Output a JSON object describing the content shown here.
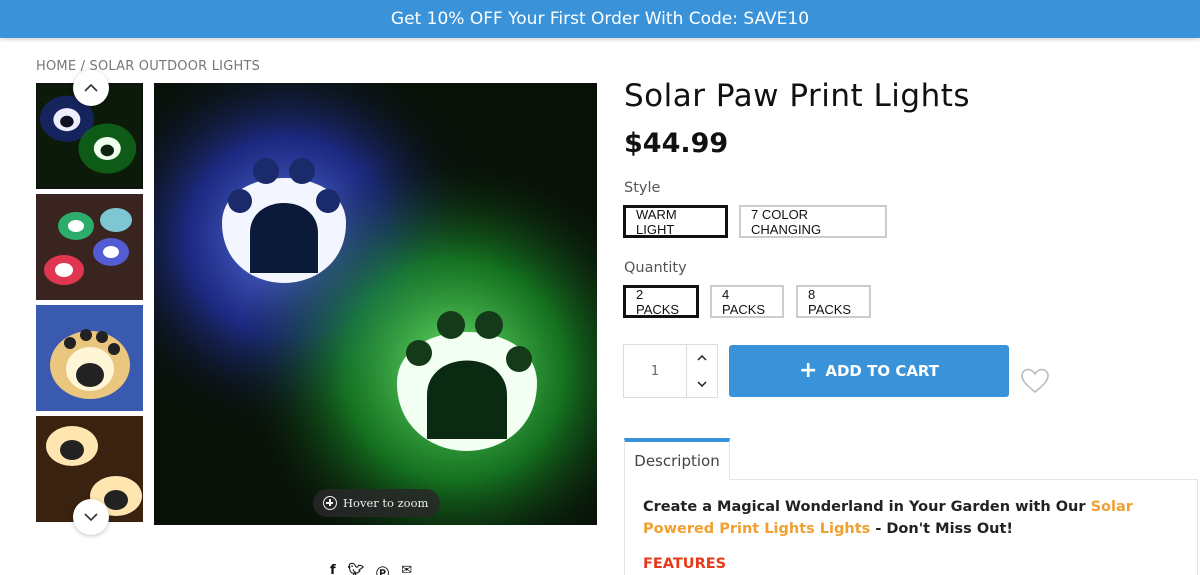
{
  "promo": {
    "text": "Get 10% OFF Your First Order With Code: SAVE10"
  },
  "breadcrumb": {
    "home": "HOME",
    "separator": " / ",
    "current": "SOLAR OUTDOOR LIGHTS"
  },
  "gallery": {
    "thumbnails": [
      "paw-lights-blue-green",
      "paw-lights-multicolor",
      "paw-light-warm",
      "paw-lights-warm-pair"
    ],
    "zoom_hint": "Hover to zoom"
  },
  "product": {
    "title": "Solar Paw Print Lights",
    "price": "$44.99",
    "style_label": "Style",
    "styles": [
      {
        "label": "WARM LIGHT",
        "selected": true
      },
      {
        "label": "7 COLOR CHANGING",
        "selected": false
      }
    ],
    "quantity_label": "Quantity",
    "packs": [
      {
        "label": "2 PACKS",
        "selected": true
      },
      {
        "label": "4 PACKS",
        "selected": false
      },
      {
        "label": "8 PACKS",
        "selected": false
      }
    ],
    "qty_value": "1",
    "add_to_cart": "ADD TO CART"
  },
  "share": {
    "icons": [
      "facebook-icon",
      "twitter-icon",
      "pinterest-icon",
      "email-icon"
    ]
  },
  "tabs": {
    "description": "Description"
  },
  "description": {
    "intro_1": "Create a Magical Wonderland in Your Garden with Our ",
    "highlight": "Solar Powered Print Lights Lights",
    "intro_2": " - Don't Miss Out!",
    "features_heading": "FEATURES"
  },
  "colors": {
    "accent": "#3a93d9",
    "highlight": "#f0a030",
    "features": "#e8381a"
  }
}
